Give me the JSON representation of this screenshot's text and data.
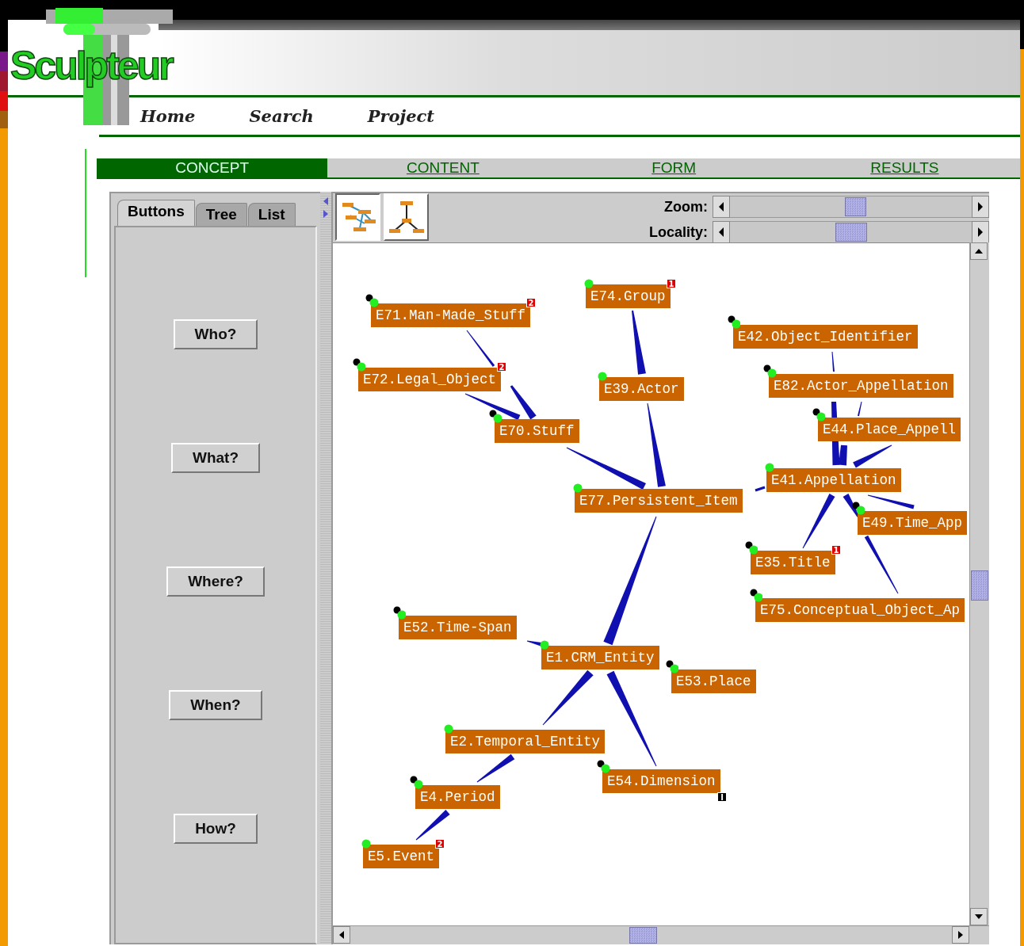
{
  "logo": "Sculpteur",
  "nav": [
    "Home",
    "Search",
    "Project"
  ],
  "steps": [
    {
      "label": "CONCEPT",
      "selected": true
    },
    {
      "label": "CONTENT",
      "selected": false
    },
    {
      "label": "FORM",
      "selected": false
    },
    {
      "label": "RESULTS",
      "selected": false
    }
  ],
  "side_tabs": [
    {
      "label": "Buttons",
      "selected": true
    },
    {
      "label": "Tree",
      "selected": false
    },
    {
      "label": "List",
      "selected": false
    }
  ],
  "query_buttons": [
    "Who?",
    "What?",
    "Where?",
    "When?",
    "How?"
  ],
  "sliders": [
    {
      "label": "Zoom:",
      "level": 0.52
    },
    {
      "label": "Locality:",
      "level": 0.5
    }
  ],
  "nodes": [
    {
      "label": "E74.Group",
      "expandable": false,
      "badge": {
        "text": "1",
        "kind": "count"
      }
    },
    {
      "label": "E71.Man-Made_Stuff",
      "expandable": true,
      "badge": {
        "text": "2",
        "kind": "count"
      }
    },
    {
      "label": "E42.Object_Identifier",
      "expandable": true
    },
    {
      "label": "E72.Legal_Object",
      "expandable": true,
      "badge": {
        "text": "2",
        "kind": "count"
      }
    },
    {
      "label": "E39.Actor",
      "expandable": false
    },
    {
      "label": "E82.Actor_Appellation",
      "expandable": true
    },
    {
      "label": "E70.Stuff",
      "expandable": true
    },
    {
      "label": "E44.Place_Appell",
      "expandable": true
    },
    {
      "label": "E41.Appellation",
      "expandable": false
    },
    {
      "label": "E77.Persistent_Item",
      "expandable": false
    },
    {
      "label": "E49.Time_App",
      "expandable": true
    },
    {
      "label": "E35.Title",
      "expandable": true,
      "badge": {
        "text": "1",
        "kind": "count"
      }
    },
    {
      "label": "E75.Conceptual_Object_Ap",
      "expandable": true
    },
    {
      "label": "E52.Time-Span",
      "expandable": true
    },
    {
      "label": "E1.CRM_Entity",
      "expandable": false
    },
    {
      "label": "E53.Place",
      "expandable": true
    },
    {
      "label": "E2.Temporal_Entity",
      "expandable": false
    },
    {
      "label": "E4.Period",
      "expandable": true
    },
    {
      "label": "E54.Dimension",
      "expandable": true,
      "badge": {
        "text": "I",
        "kind": "info"
      }
    },
    {
      "label": "E5.Event",
      "expandable": false,
      "badge": {
        "text": "2",
        "kind": "count"
      }
    }
  ]
}
